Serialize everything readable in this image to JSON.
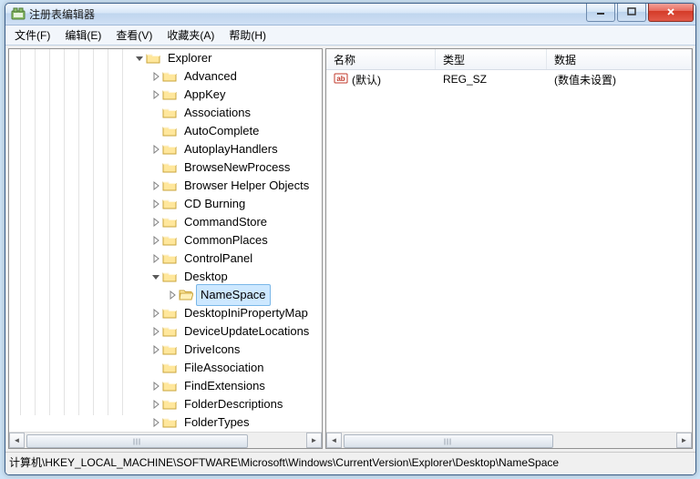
{
  "window": {
    "title": "注册表编辑器"
  },
  "menu": {
    "items": [
      {
        "label": "文件(F)"
      },
      {
        "label": "编辑(E)"
      },
      {
        "label": "查看(V)"
      },
      {
        "label": "收藏夹(A)"
      },
      {
        "label": "帮助(H)"
      }
    ]
  },
  "tree": {
    "parent": "Explorer",
    "selected": "NameSpace",
    "children": [
      {
        "label": "Advanced",
        "expandable": true
      },
      {
        "label": "AppKey",
        "expandable": true
      },
      {
        "label": "Associations",
        "expandable": false
      },
      {
        "label": "AutoComplete",
        "expandable": false
      },
      {
        "label": "AutoplayHandlers",
        "expandable": true
      },
      {
        "label": "BrowseNewProcess",
        "expandable": false
      },
      {
        "label": "Browser Helper Objects",
        "expandable": true
      },
      {
        "label": "CD Burning",
        "expandable": true
      },
      {
        "label": "CommandStore",
        "expandable": true
      },
      {
        "label": "CommonPlaces",
        "expandable": true
      },
      {
        "label": "ControlPanel",
        "expandable": true
      },
      {
        "label": "Desktop",
        "expandable": true,
        "expanded": true,
        "child": "NameSpace"
      },
      {
        "label": "DesktopIniPropertyMap",
        "expandable": true
      },
      {
        "label": "DeviceUpdateLocations",
        "expandable": true
      },
      {
        "label": "DriveIcons",
        "expandable": true
      },
      {
        "label": "FileAssociation",
        "expandable": false
      },
      {
        "label": "FindExtensions",
        "expandable": true
      },
      {
        "label": "FolderDescriptions",
        "expandable": true
      },
      {
        "label": "FolderTypes",
        "expandable": true
      }
    ]
  },
  "list": {
    "headers": {
      "name": "名称",
      "type": "类型",
      "data": "数据"
    },
    "rows": [
      {
        "name": "(默认)",
        "type": "REG_SZ",
        "data": "(数值未设置)"
      }
    ]
  },
  "statusbar": {
    "path": "计算机\\HKEY_LOCAL_MACHINE\\SOFTWARE\\Microsoft\\Windows\\CurrentVersion\\Explorer\\Desktop\\NameSpace"
  }
}
